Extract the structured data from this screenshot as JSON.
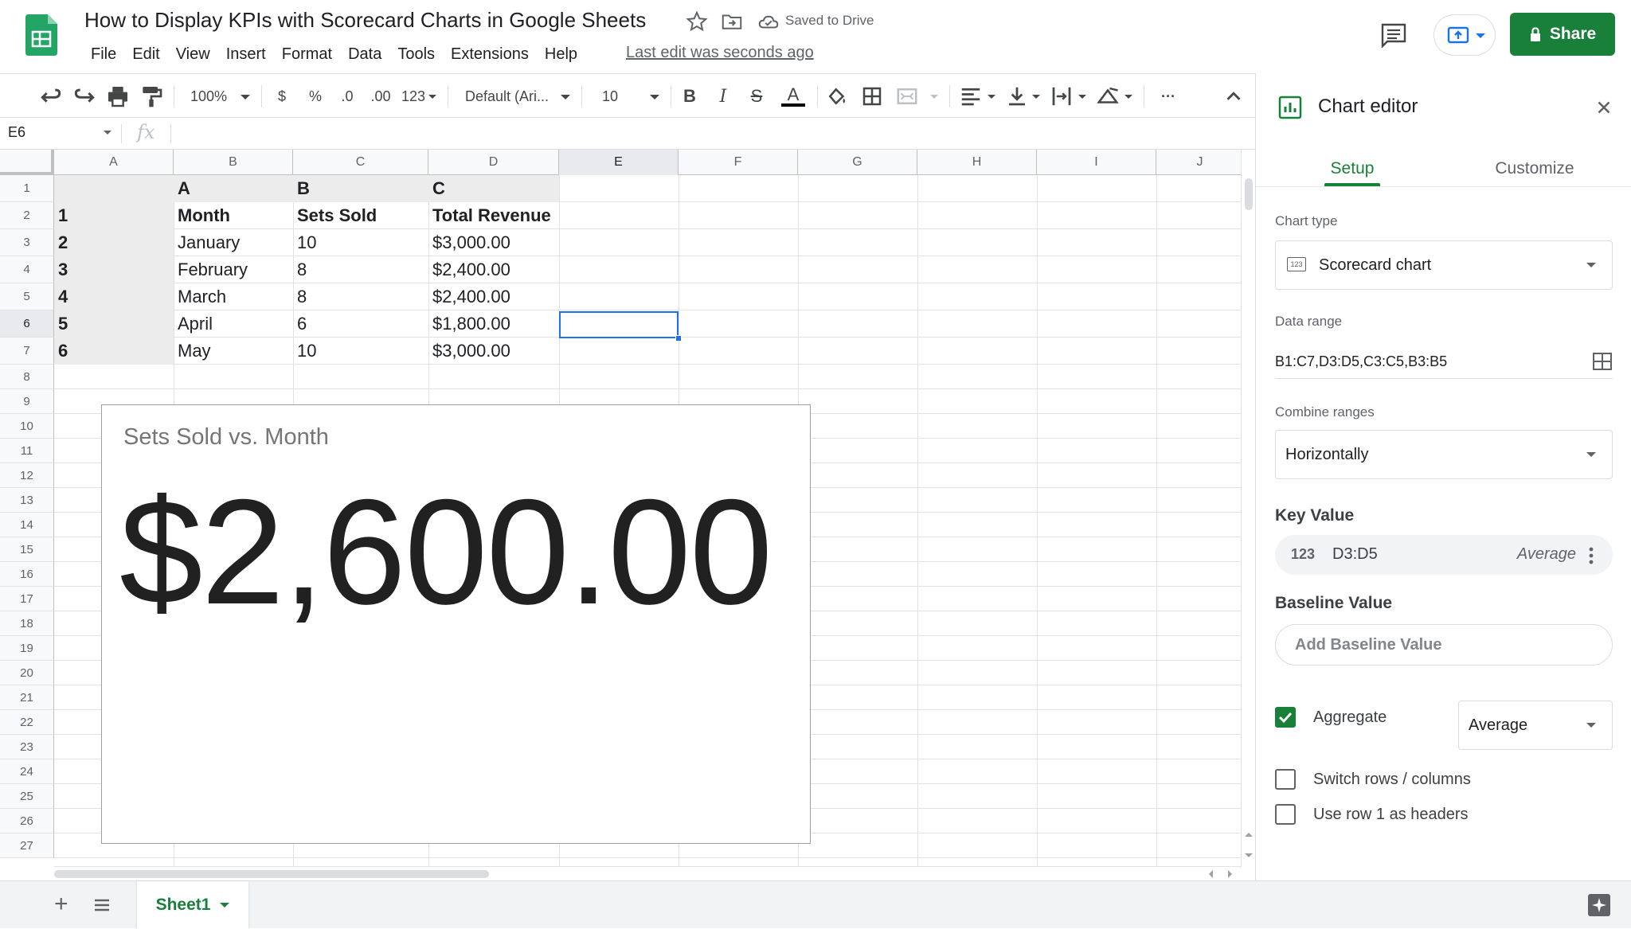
{
  "header": {
    "title": "How to Display KPIs with Scorecard Charts in Google Sheets",
    "saved_status": "Saved to Drive",
    "last_edit": "Last edit was seconds ago",
    "share_label": "Share"
  },
  "menu": [
    "File",
    "Edit",
    "View",
    "Insert",
    "Format",
    "Data",
    "Tools",
    "Extensions",
    "Help"
  ],
  "toolbar": {
    "zoom": "100%",
    "currency": "$",
    "percent": "%",
    "decrease_decimal": ".0",
    "increase_decimal": ".00",
    "more_formats": "123",
    "font": "Default (Ari...",
    "font_size": "10",
    "bold": "B",
    "italic": "I",
    "strikethrough": "S",
    "text_color": "A",
    "more": "···"
  },
  "formula_bar": {
    "name_box": "E6",
    "fx": "fx"
  },
  "grid": {
    "columns": [
      "A",
      "B",
      "C",
      "D",
      "E",
      "F",
      "G",
      "H",
      "I",
      "J"
    ],
    "rows": [
      "1",
      "2",
      "3",
      "4",
      "5",
      "6",
      "7",
      "8",
      "9",
      "10",
      "11",
      "12",
      "13",
      "14",
      "15",
      "16",
      "17",
      "18",
      "19",
      "20",
      "21",
      "22",
      "23",
      "24",
      "25",
      "26",
      "27"
    ],
    "table": [
      [
        "",
        "A",
        "B",
        "C"
      ],
      [
        "1",
        "Month",
        "Sets Sold",
        "Total Revenue"
      ],
      [
        "2",
        "January",
        "10",
        "$3,000.00"
      ],
      [
        "3",
        "February",
        "8",
        "$2,400.00"
      ],
      [
        "4",
        "March",
        "8",
        "$2,400.00"
      ],
      [
        "5",
        "April",
        "6",
        "$1,800.00"
      ],
      [
        "6",
        "May",
        "10",
        "$3,000.00"
      ]
    ],
    "selected_cell": "E6"
  },
  "chart": {
    "title": "Sets Sold vs. Month",
    "value": "$2,600.00"
  },
  "sheets": {
    "active_tab": "Sheet1"
  },
  "editor": {
    "title": "Chart editor",
    "tabs": [
      "Setup",
      "Customize"
    ],
    "chart_type_label": "Chart type",
    "chart_type_icon": "123",
    "chart_type_value": "Scorecard chart",
    "data_range_label": "Data range",
    "data_range_value": "B1:C7,D3:D5,C3:C5,B3:B5",
    "combine_label": "Combine ranges",
    "combine_value": "Horizontally",
    "key_value_label": "Key Value",
    "key_value_icon": "123",
    "key_value_range": "D3:D5",
    "key_value_agg": "Average",
    "baseline_label": "Baseline Value",
    "baseline_placeholder": "Add Baseline Value",
    "aggregate_label": "Aggregate",
    "aggregate_checked": true,
    "aggregate_value": "Average",
    "switch_label": "Switch rows / columns",
    "switch_checked": false,
    "headers_label": "Use row 1 as headers",
    "headers_checked": false
  },
  "colors": {
    "accent_green": "#188038",
    "selection_blue": "#1a73e8",
    "header_shade": "#ececec"
  }
}
